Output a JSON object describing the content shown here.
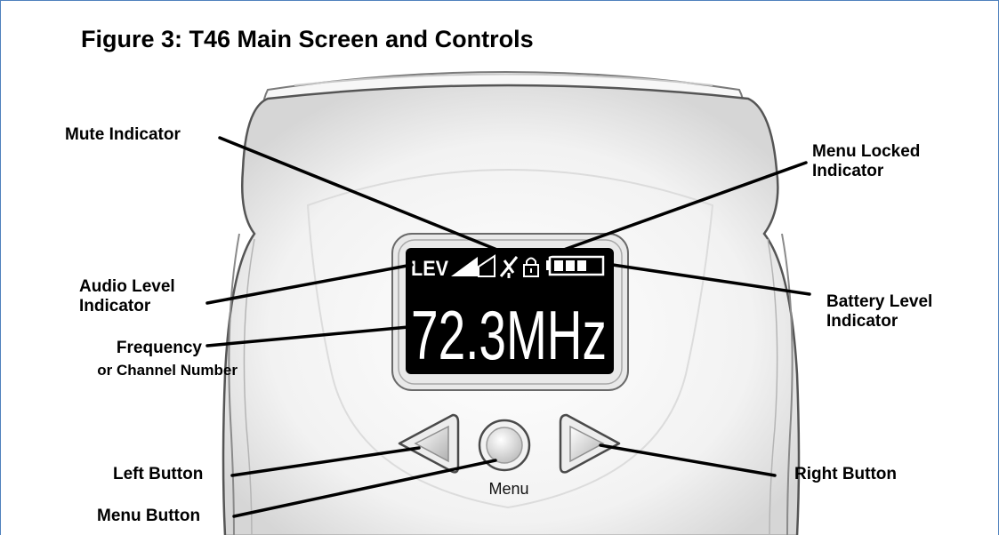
{
  "figure": {
    "title": "Figure 3: T46 Main Screen and Controls"
  },
  "display": {
    "level_tag": "LEV",
    "frequency": "72.3MHz",
    "icons": [
      "audio-level-bars-icon",
      "mute-microphone-icon",
      "lock-icon",
      "battery-icon"
    ]
  },
  "controls": {
    "menu_label": "Menu"
  },
  "labels": {
    "mute_indicator": "Mute Indicator",
    "menu_locked_line1": "Menu Locked",
    "menu_locked_line2": "Indicator",
    "audio_level_line1": "Audio Level",
    "audio_level_line2": "Indicator",
    "battery_level_line1": "Battery Level",
    "battery_level_line2": "Indicator",
    "frequency_line1": "Frequency",
    "frequency_line2": "or Channel Number",
    "left_button": "Left Button",
    "right_button": "Right Button",
    "menu_button": "Menu Button"
  },
  "colors": {
    "frame_border": "#4f81bd",
    "lcd_background": "#000000",
    "lcd_text": "#ffffff",
    "device_body": "#f4f4f4"
  }
}
